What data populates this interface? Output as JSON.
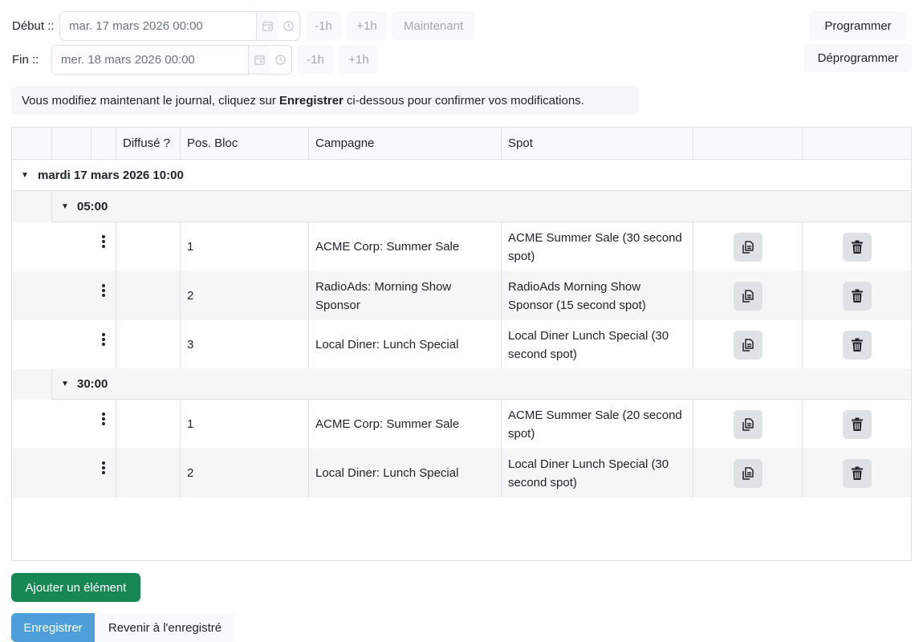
{
  "start": {
    "label": "Début ::",
    "value": "mar. 17 mars 2026 00:00",
    "minus_label": "-1h",
    "plus_label": "+1h",
    "now_label": "Maintenant"
  },
  "end": {
    "label": "Fin ::",
    "value": "mer. 18 mars 2026 00:00",
    "minus_label": "-1h",
    "plus_label": "+1h"
  },
  "actions": {
    "schedule_label": "Programmer",
    "unschedule_label": "Déprogrammer"
  },
  "notice": {
    "before": "Vous modifiez maintenant le journal, cliquez sur",
    "bold": "Enregistrer",
    "after": "ci-dessous pour confirmer vos modifications."
  },
  "table": {
    "headers": {
      "aired": "Diffusé ?",
      "pos": "Pos. Bloc",
      "campaign": "Campagne",
      "spot": "Spot"
    },
    "day_group": "mardi 17 mars 2026 10:00",
    "groups": [
      {
        "label": "05:00",
        "rows": [
          {
            "pos": "1",
            "campaign": "ACME Corp: Summer Sale",
            "spot": "ACME Summer Sale (30 second spot)"
          },
          {
            "pos": "2",
            "campaign": "RadioAds: Morning Show Sponsor",
            "spot": "RadioAds Morning Show Sponsor (15 second spot)"
          },
          {
            "pos": "3",
            "campaign": "Local Diner: Lunch Special",
            "spot": "Local Diner Lunch Special (30 second spot)"
          }
        ]
      },
      {
        "label": "30:00",
        "rows": [
          {
            "pos": "1",
            "campaign": "ACME Corp: Summer Sale",
            "spot": "ACME Summer Sale (20 second spot)"
          },
          {
            "pos": "2",
            "campaign": "Local Diner: Lunch Special",
            "spot": "Local Diner Lunch Special (30 second spot)"
          }
        ]
      }
    ]
  },
  "footer": {
    "add_label": "Ajouter un élément",
    "save_label": "Enregistrer",
    "revert_label": "Revenir à l'enregistré"
  },
  "icons": {
    "calendar": "calendar-icon",
    "clock": "clock-icon",
    "duplicate": "copy-icon",
    "delete": "trash-icon",
    "row_menu": "kebab-menu-icon",
    "collapse": "caret-down-icon"
  },
  "colors": {
    "primary": "#4e9fd9",
    "success": "#198754",
    "border": "#dee2e6",
    "group_bg": "#f6f6f6"
  }
}
